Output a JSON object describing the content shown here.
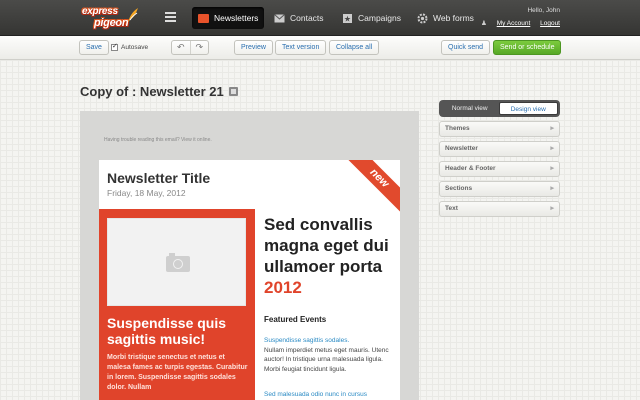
{
  "logo": {
    "line1": "express",
    "line2": "pigeon"
  },
  "nav": {
    "newsletters": "Newsletters",
    "contacts": "Contacts",
    "campaigns": "Campaigns",
    "webforms": "Web forms"
  },
  "user": {
    "greeting": "Hello, John",
    "account": "My Account",
    "logout": "Logout"
  },
  "toolbar": {
    "save": "Save",
    "autosave": "Autosave",
    "preview": "Preview",
    "text_version": "Text version",
    "collapse_all": "Collapse all",
    "quick_send": "Quick send",
    "send_or_schedule": "Send or schedule"
  },
  "page": {
    "title": "Copy of : Newsletter 21"
  },
  "email": {
    "trouble": "Having trouble reading this email? View it online.",
    "ribbon": "new",
    "title": "Newsletter Title",
    "date": "Friday, 18 May, 2012",
    "red_heading": "Suspendisse quis sagittis music!",
    "red_body": "Morbi tristique senectus et netus et malesa fames ac turpis egestas. Curabitur in lorem. Suspendisse sagittis sodales dolor. Nullam",
    "big_heading": "Sed convallis magna eget dui ullamoer porta",
    "big_heading_year": "2012",
    "featured": "Featured Events",
    "event1_link": "Suspendisse sagittis sodales.",
    "event1_text": "Nullam imperdiet metus eget mauris. Utenc auctor! In tristique urna malesuada ligula. Morbi feugiat tincidunt ligula.",
    "event2_link": "Sed malesuada odio nunc in cursus"
  },
  "panel": {
    "normal_view": "Normal view",
    "design_view": "Design view",
    "sections": [
      "Themes",
      "Newsletter",
      "Header & Footer",
      "Sections",
      "Text"
    ]
  },
  "colors": {
    "accent_red": "#e0442b",
    "green": "#57a826",
    "link_blue": "#2a6fb0"
  }
}
